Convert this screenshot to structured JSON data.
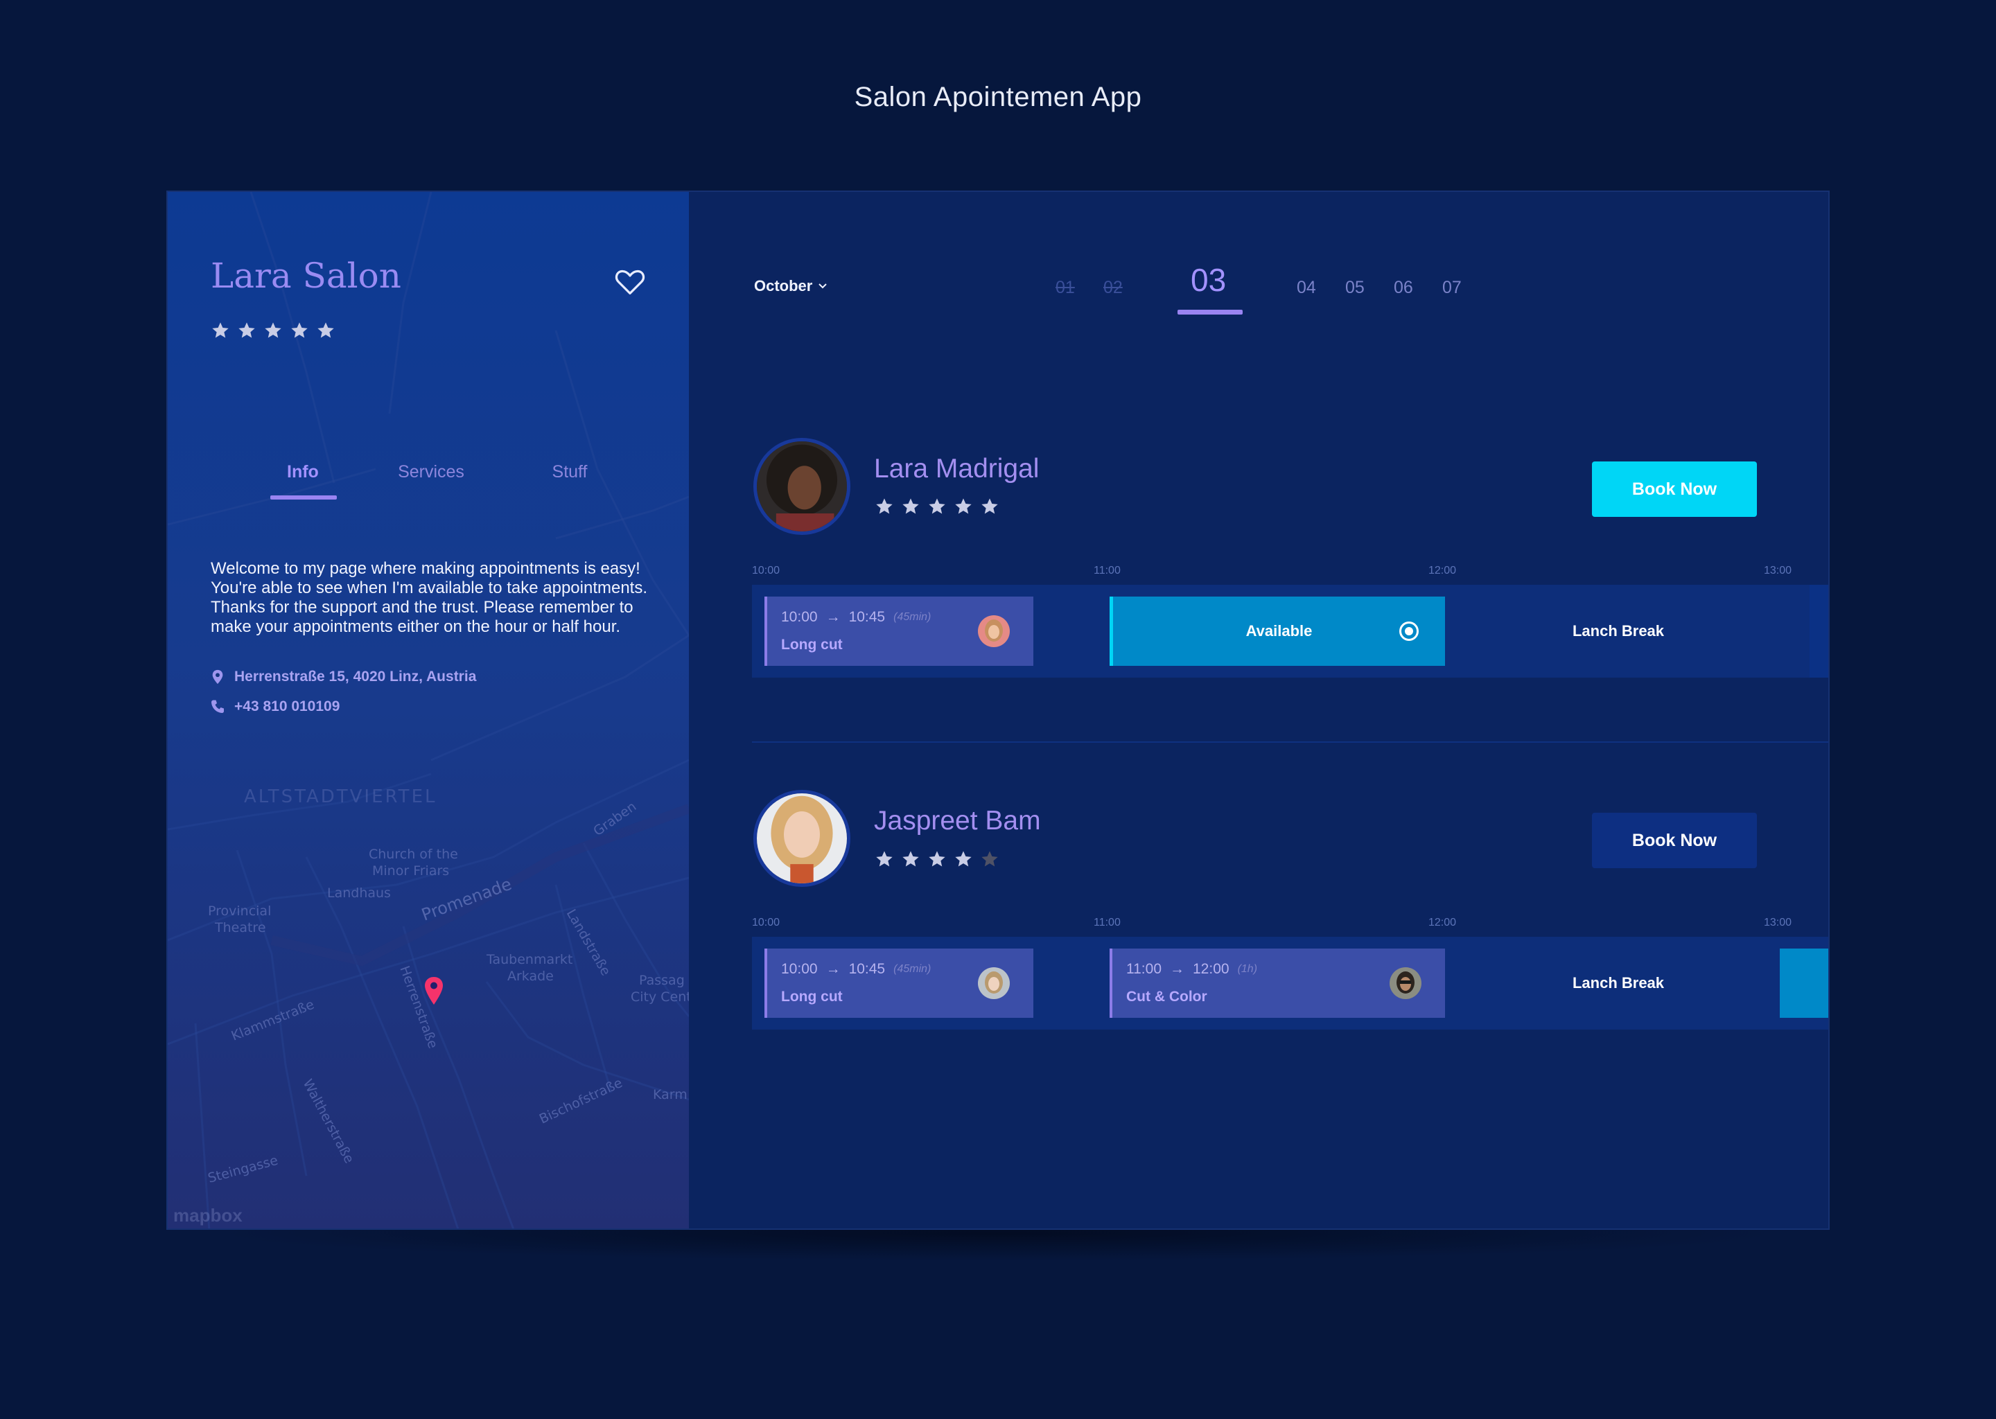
{
  "page": {
    "title": "Salon Apointemen App"
  },
  "salon": {
    "name": "Lara Salon",
    "rating": 5,
    "tabs": [
      {
        "label": "Info",
        "active": true
      },
      {
        "label": "Services",
        "active": false
      },
      {
        "label": "Stuff",
        "active": false
      }
    ],
    "welcome": "Welcome to my page where making appointments is easy! You're able to see when I'm available to take appointments. Thanks for the support and the trust. Please remember to make your appointments either on the hour or half hour.",
    "address": "Herrenstraße 15, 4020 Linz, Austria",
    "phone": "+43 810 010109"
  },
  "map": {
    "labels": {
      "district": "ALTSTADTVIERTEL",
      "church_line1": "Church of the",
      "church_line2": "Minor Friars",
      "landhaus": "Landhaus",
      "promenade": "Promenade",
      "theatre_line1": "Provincial",
      "theatre_line2": "Theatre",
      "taubenmarkt_line1": "Taubenmarkt",
      "taubenmarkt_line2": "Arkade",
      "passage_line1": "Passag",
      "passage_line2": "City Cent",
      "klammstrasse": "Klammstraße",
      "herrenstrasse": "Herrenstraße",
      "landstrasse": "Landstraße",
      "waltherstrasse": "Waltherstraße",
      "bischofstrasse": "Bischofstraße",
      "steingasse": "Steingasse",
      "graben": "Graben",
      "karm": "Karm",
      "mapbox": "mapbox"
    }
  },
  "calendar": {
    "month": "October",
    "days": [
      {
        "label": "01",
        "state": "past"
      },
      {
        "label": "02",
        "state": "past"
      },
      {
        "label": "03",
        "state": "active"
      },
      {
        "label": "04",
        "state": "future"
      },
      {
        "label": "05",
        "state": "future"
      },
      {
        "label": "06",
        "state": "future"
      },
      {
        "label": "07",
        "state": "future"
      }
    ]
  },
  "timeline_labels": [
    "10:00",
    "11:00",
    "12:00",
    "13:00"
  ],
  "stylists": [
    {
      "name": "Lara Madrigal",
      "rating": 5,
      "book_label": "Book Now",
      "slots": [
        {
          "type": "appointment",
          "start": "10:00",
          "end": "10:45",
          "duration": "(45min)",
          "service": "Long cut"
        },
        {
          "type": "available",
          "label": "Available"
        },
        {
          "type": "break",
          "label": "Lanch Break"
        }
      ]
    },
    {
      "name": "Jaspreet Bam",
      "rating": 4,
      "book_label": "Book Now",
      "slots": [
        {
          "type": "appointment",
          "start": "10:00",
          "end": "10:45",
          "duration": "(45min)",
          "service": "Long cut"
        },
        {
          "type": "appointment",
          "start": "11:00",
          "end": "12:00",
          "duration": "(1h)",
          "service": "Cut & Color"
        },
        {
          "type": "break",
          "label": "Lanch Break"
        }
      ]
    }
  ],
  "colors": {
    "background": "#06173d",
    "accent_purple": "#9a84f2",
    "accent_cyan": "#00d6f6",
    "available": "#0089c8",
    "appointment": "#3b4ea8"
  }
}
